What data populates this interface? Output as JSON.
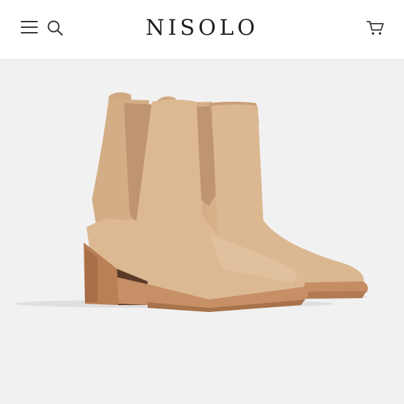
{
  "header": {
    "brand": "NISOLO",
    "menu_icon": "hamburger-menu-icon",
    "search_icon": "search-icon",
    "cart_icon": "shopping-cart-icon"
  },
  "product_image": {
    "colors": {
      "background": "#f2f1f2",
      "leather": "#d8b38c",
      "elastic": "#c49a78",
      "heel_wood": "#b97f55",
      "sole": "#c9916a"
    }
  }
}
